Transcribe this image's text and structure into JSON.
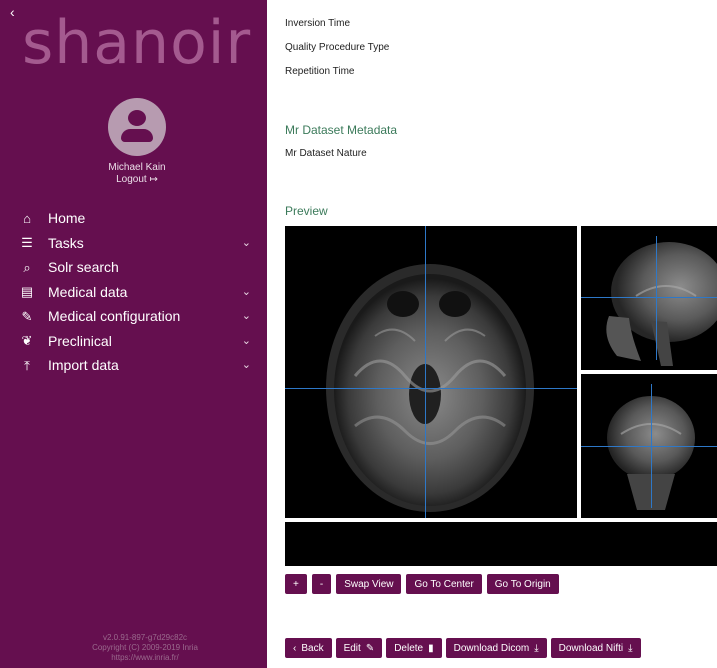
{
  "sidebar": {
    "collapse_glyph": "‹",
    "logo_text": "shanoir",
    "user": {
      "name": "Michael Kain",
      "logout_label": "Logout",
      "logout_icon": "sign-out-icon"
    },
    "nav": [
      {
        "label": "Home",
        "icon": "home-icon",
        "has_caret": false
      },
      {
        "label": "Tasks",
        "icon": "tasks-icon",
        "has_caret": true
      },
      {
        "label": "Solr search",
        "icon": "search-icon",
        "has_caret": false
      },
      {
        "label": "Medical data",
        "icon": "file-icon",
        "has_caret": true
      },
      {
        "label": "Medical configuration",
        "icon": "wrench-icon",
        "has_caret": true
      },
      {
        "label": "Preclinical",
        "icon": "mouse-icon",
        "has_caret": true
      },
      {
        "label": "Import data",
        "icon": "upload-icon",
        "has_caret": true
      }
    ],
    "version": {
      "line1": "v2.0.91-897-g7d29c82c",
      "line2": "Copyright (C) 2009-2019 Inria",
      "line3": "https://www.inria.fr/"
    }
  },
  "main": {
    "fields": [
      "Inversion Time",
      "Quality Procedure Type",
      "Repetition Time"
    ],
    "metadata_title": "Mr Dataset Metadata",
    "metadata_fields": [
      "Mr Dataset Nature"
    ],
    "preview_title": "Preview",
    "crosshair_color": "#2e78c8",
    "viewer_controls": [
      "+",
      "-",
      "Swap View",
      "Go To Center",
      "Go To Origin"
    ],
    "actions": {
      "back": "Back",
      "edit": "Edit",
      "delete": "Delete",
      "download_dicom": "Download Dicom",
      "download_nifti": "Download Nifti"
    }
  },
  "colors": {
    "brand": "#650f4f",
    "section_heading": "#3b7a5a",
    "crosshair": "#2e78c8"
  }
}
